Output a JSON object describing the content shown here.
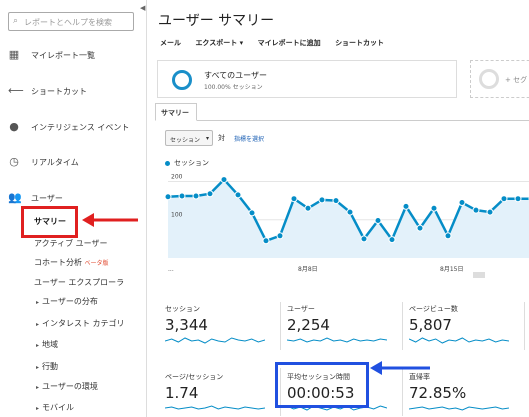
{
  "sidebar": {
    "search_placeholder": "レポートとヘルプを検索",
    "items": [
      {
        "label": "マイレポート一覧",
        "icon": "grid-icon"
      },
      {
        "label": "ショートカット",
        "icon": "shortcut-arrow-icon"
      },
      {
        "label": "インテリジェンス イベント",
        "icon": "lightbulb-icon"
      },
      {
        "label": "リアルタイム",
        "icon": "clock-icon"
      },
      {
        "label": "ユーザー",
        "icon": "users-icon"
      }
    ],
    "sub_items": [
      {
        "label": "サマリー"
      },
      {
        "label": "アクティブ ユーザー"
      },
      {
        "label": "コホート分析",
        "badge": "ベータ版"
      },
      {
        "label": "ユーザー エクスプローラ"
      },
      {
        "label": "ユーザーの分布"
      },
      {
        "label": "インタレスト カテゴリ"
      },
      {
        "label": "地域"
      },
      {
        "label": "行動"
      },
      {
        "label": "ユーザーの環境"
      },
      {
        "label": "モバイル"
      }
    ]
  },
  "main": {
    "title": "ユーザー サマリー",
    "toolbar": [
      "メール",
      "エクスポート ▾",
      "マイレポートに追加",
      "ショートカット"
    ],
    "segment": {
      "name": "すべてのユーザー",
      "sub": "100.00% セッション"
    },
    "segment_add": "+ セグ",
    "tab": "サマリー",
    "metric_select": "セッション",
    "vs_label": "対",
    "pick_metric": "指標を選択",
    "legend": "セッション"
  },
  "chart_data": {
    "type": "line",
    "series": [
      {
        "name": "セッション",
        "values": [
          160,
          162,
          162,
          168,
          205,
          165,
          118,
          45,
          58,
          155,
          130,
          152,
          150,
          120,
          50,
          98,
          48,
          135,
          78,
          130,
          58,
          145,
          125,
          120,
          155,
          155,
          155
        ]
      }
    ],
    "x_tick_labels": [
      "...",
      "8月8日",
      "8月15日"
    ],
    "y_tick_labels": [
      "200",
      "100"
    ],
    "ylim": [
      0,
      230
    ],
    "color": "#058dc7",
    "fill": "#e3f1fa"
  },
  "metrics": [
    {
      "label": "セッション",
      "value": "3,344"
    },
    {
      "label": "ユーザー",
      "value": "2,254"
    },
    {
      "label": "ページビュー数",
      "value": "5,807"
    },
    {
      "label": "ページ/セッション",
      "value": "1.74"
    },
    {
      "label": "平均セッション時間",
      "value": "00:00:53"
    },
    {
      "label": "直帰率",
      "value": "72.85%"
    }
  ],
  "colors": {
    "accent": "#058dc7",
    "highlight_red": "#e02020",
    "highlight_blue": "#2050e0"
  }
}
